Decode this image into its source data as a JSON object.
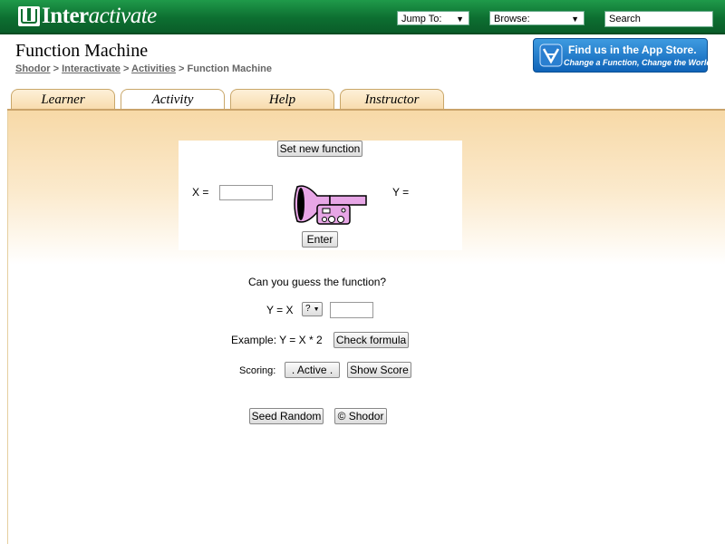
{
  "header": {
    "brand_bold": "Inter",
    "brand_italic": "activate",
    "jump_to": "Jump To:",
    "browse": "Browse:",
    "search": "Search"
  },
  "page": {
    "title": "Function Machine",
    "breadcrumbs": [
      "Shodor",
      "Interactivate",
      "Activities"
    ],
    "current": "Function Machine",
    "separator": ">"
  },
  "appstore": {
    "line1": "Find us in the App Store.",
    "line2": "Change a Function, Change the World"
  },
  "tabs": [
    "Learner",
    "Activity",
    "Help",
    "Instructor"
  ],
  "active_tab": "Activity",
  "applet": {
    "set_new_function": "Set new function",
    "x_label": "X =",
    "x_value": "",
    "y_label": "Y =",
    "enter": "Enter"
  },
  "guess": {
    "prompt": "Can you guess the function?",
    "formula_prefix": "Y = X",
    "operator": "?",
    "operand": "",
    "example": "Example: Y = X * 2",
    "check": "Check formula",
    "scoring_label": "Scoring:",
    "scoring_state": ". Active .",
    "show_score": "Show Score",
    "seed_random": "Seed Random",
    "copyright": "© Shodor"
  },
  "colors": {
    "header_green": "#0d6f31",
    "tab_fill": "#f8dcae",
    "machine_pink": "#e7a6e6"
  }
}
